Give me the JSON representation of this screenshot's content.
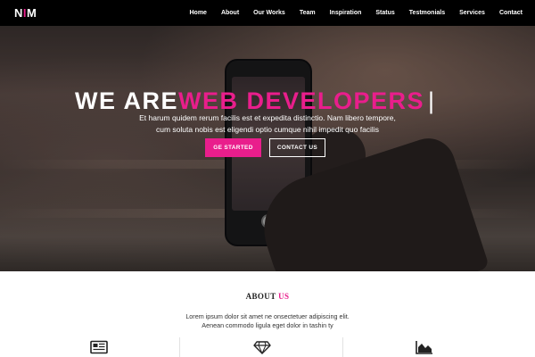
{
  "header": {
    "logo": {
      "part1": "N",
      "part2": "I",
      "part3": "M"
    },
    "nav": [
      "Home",
      "About",
      "Our Works",
      "Team",
      "Inspiration",
      "Status",
      "Testmonials",
      "Services",
      "Contact"
    ]
  },
  "hero": {
    "headline_white": "WE ARE",
    "headline_pink": "WEB DEVELOPERS",
    "cursor": "|",
    "subtitle_line1": "Et harum quidem rerum facilis est et expedita distinctio. Nam libero tempore,",
    "subtitle_line2": "cum soluta nobis est eligendi optio cumque nihil impedit quo facilis",
    "btn_start": "GE STARTED",
    "btn_contact": "CONTACT US"
  },
  "about": {
    "title_main": "ABOUT",
    "title_accent": "US",
    "text_line1": "Lorem ipsum dolor sit amet ne onsectetuer adipiscing elit.",
    "text_line2": "Aenean commodo ligula eget dolor in tashin ty",
    "icons": [
      "newspaper-icon",
      "diamond-icon",
      "area-chart-icon"
    ]
  },
  "colors": {
    "accent": "#e91e8c",
    "navbar_bg": "#000000"
  }
}
